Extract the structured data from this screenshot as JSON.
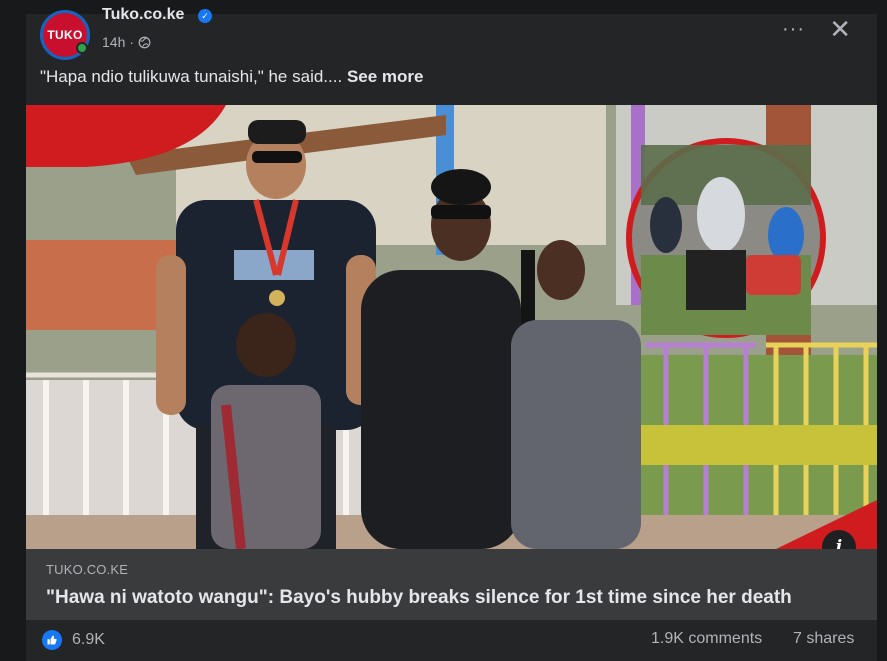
{
  "post": {
    "source_name": "Tuko.co.ke",
    "logo_text": "TUKO",
    "time": "14h",
    "caption": "\"Hapa ndio tulikuwa tunaishi,\" he said....",
    "see_more": "See more",
    "more_icon": "···",
    "close_icon": "✕"
  },
  "link": {
    "domain": "TUKO.CO.KE",
    "headline": "\"Hawa ni watoto wangu\": Bayo's hubby breaks silence for 1st time since her death"
  },
  "stats": {
    "likes": "6.9K",
    "comments": "1.9K comments",
    "shares": "7 shares"
  },
  "colors": {
    "background": "#18191a",
    "card": "#242526",
    "link_box": "#3a3b3c",
    "brand_red": "#c8102e",
    "facebook_blue": "#1877f2"
  },
  "icons": [
    "globe-icon",
    "verified-icon",
    "more-icon",
    "close-icon",
    "info-icon",
    "like-icon"
  ]
}
